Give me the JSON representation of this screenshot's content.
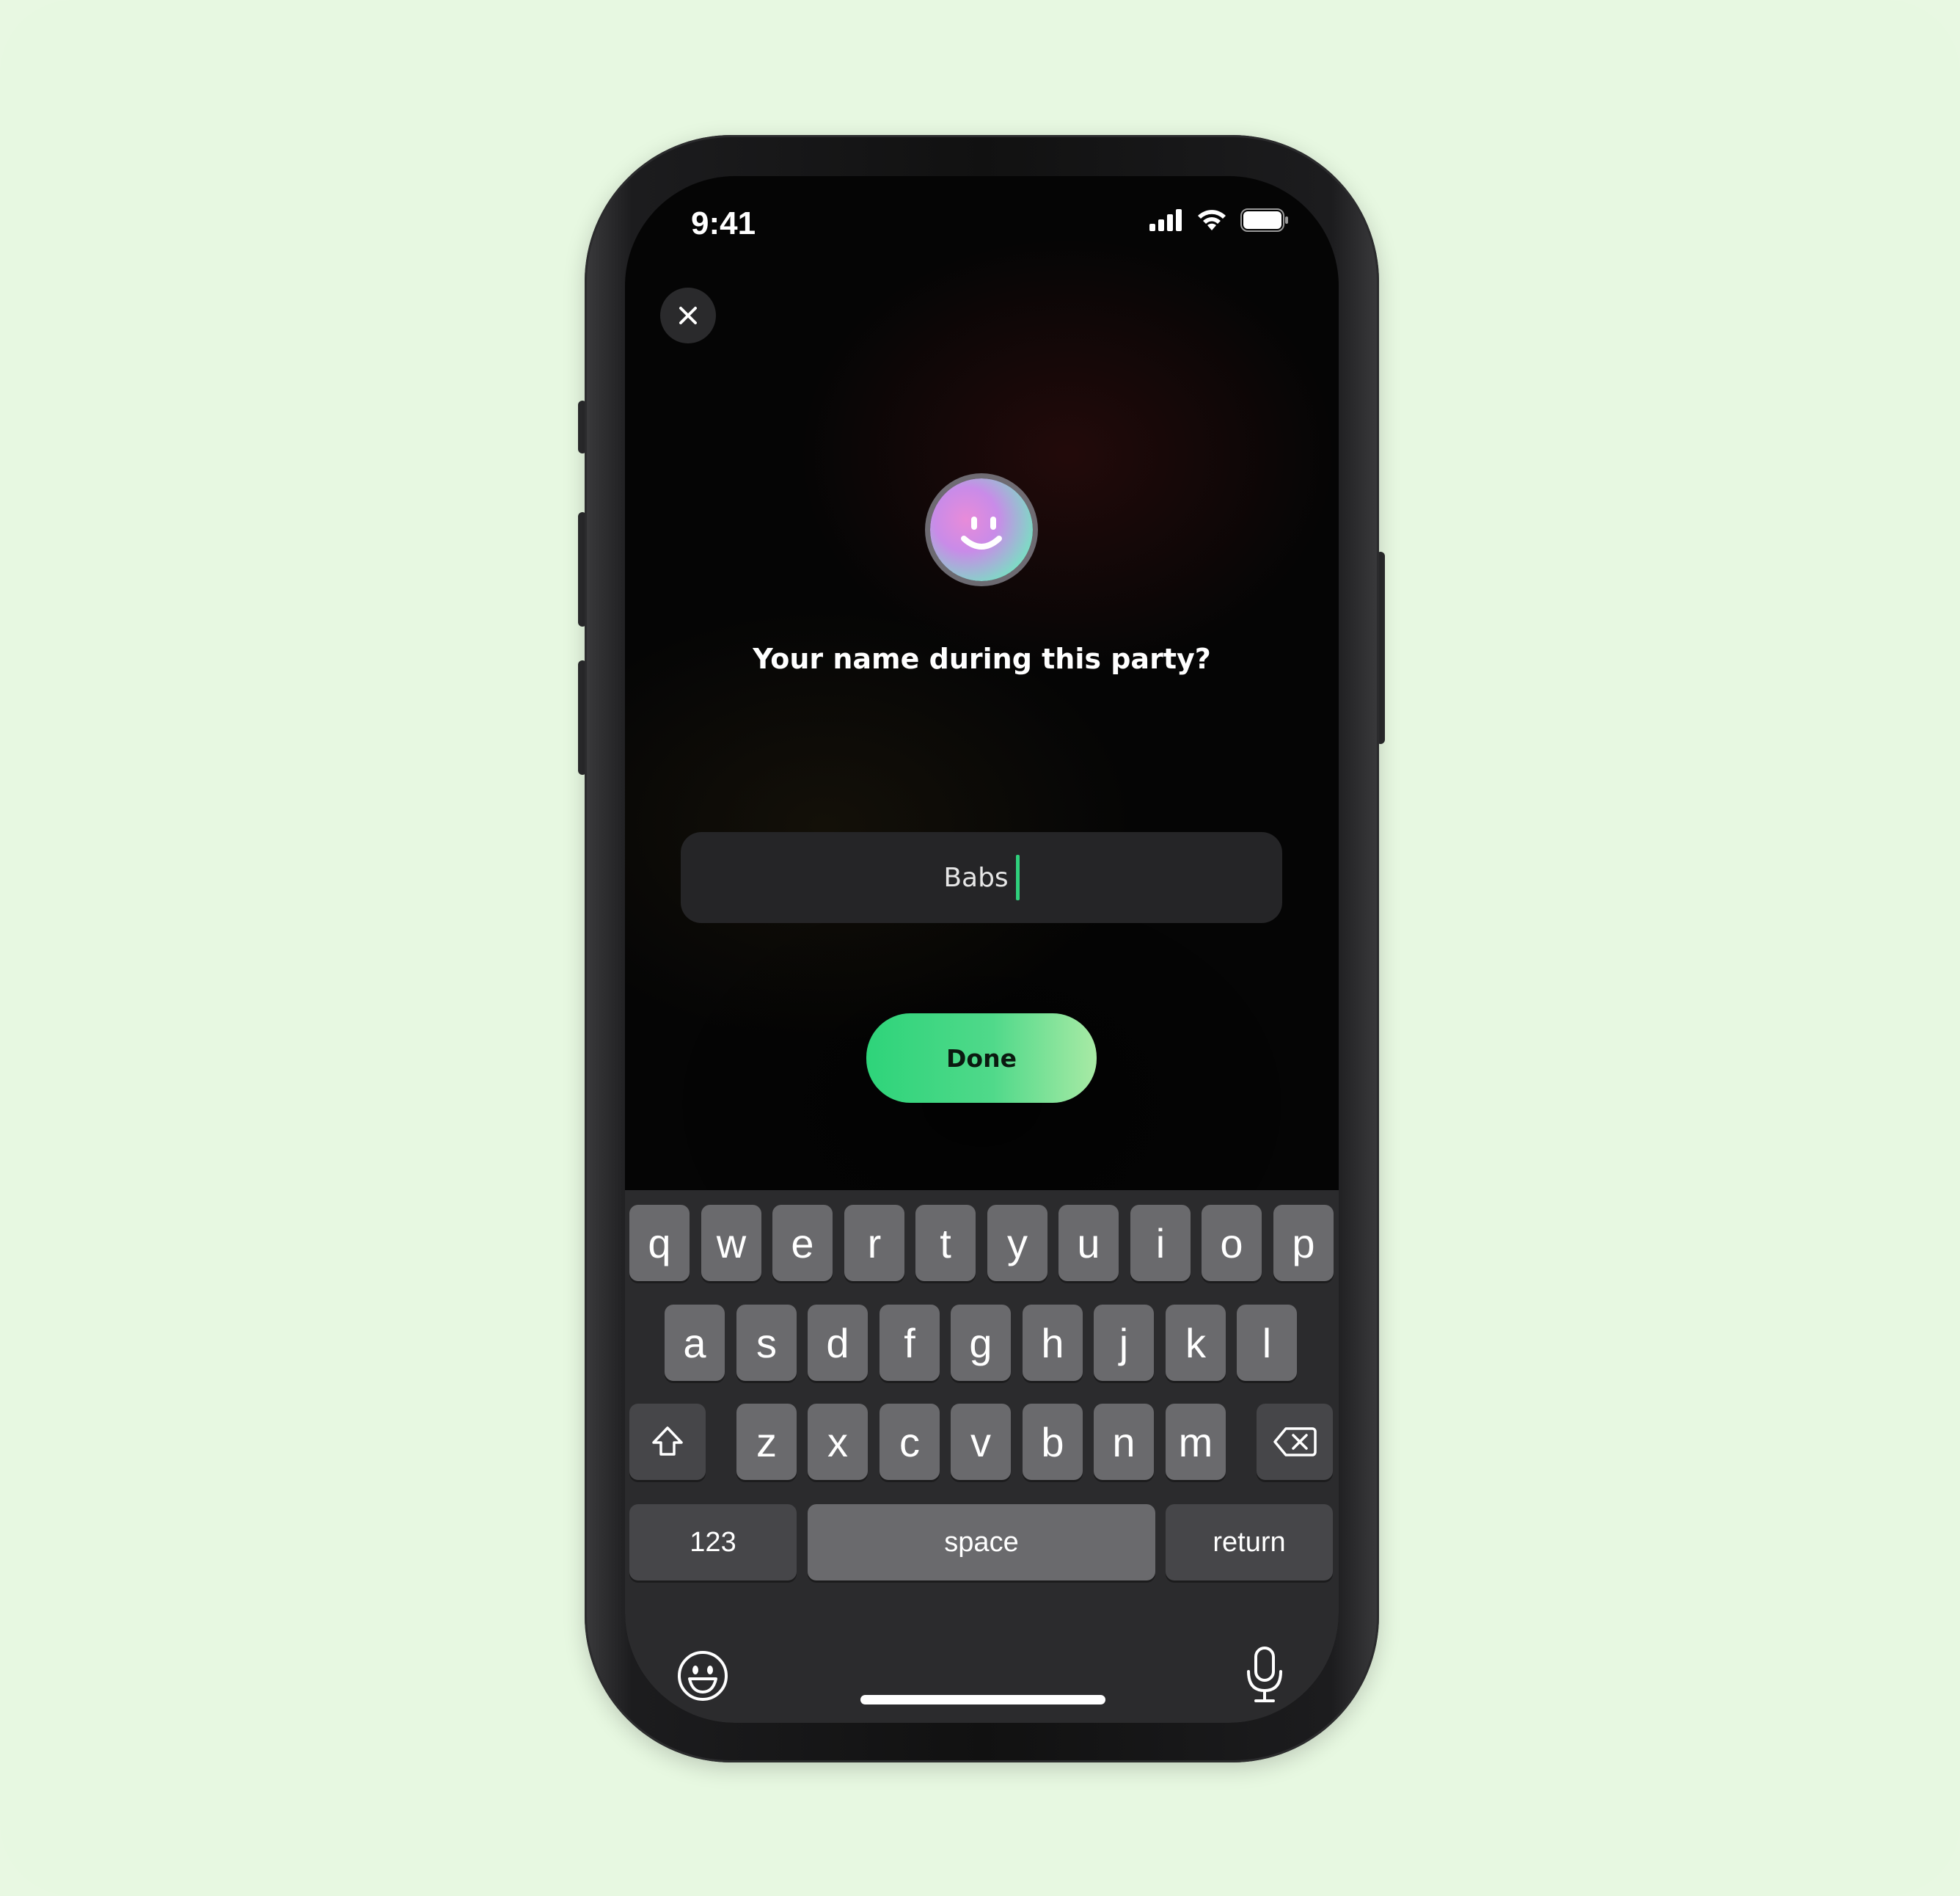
{
  "status_bar": {
    "time": "9:41",
    "icons": [
      "signal-icon",
      "wifi-icon",
      "battery-icon"
    ]
  },
  "header": {
    "close_icon": "close-icon"
  },
  "prompt": {
    "avatar_icon": "smiley-avatar-icon",
    "question": "Your name during this party?"
  },
  "name_field": {
    "value": "Babs"
  },
  "actions": {
    "done_label": "Done"
  },
  "keyboard": {
    "row1": [
      "q",
      "w",
      "e",
      "r",
      "t",
      "y",
      "u",
      "i",
      "o",
      "p"
    ],
    "row2": [
      "a",
      "s",
      "d",
      "f",
      "g",
      "h",
      "j",
      "k",
      "l"
    ],
    "row3": [
      "z",
      "x",
      "c",
      "v",
      "b",
      "n",
      "m"
    ],
    "shift_icon": "shift-icon",
    "delete_icon": "backspace-icon",
    "numbers_label": "123",
    "space_label": "space",
    "return_label": "return",
    "emoji_icon": "emoji-icon",
    "mic_icon": "microphone-icon"
  },
  "colors": {
    "background": "#e7f8e1",
    "accent_green": "#2ed47a",
    "caret": "#2fd07c",
    "key": "#6a6a6d",
    "keyboard_bg": "#2b2b2d"
  }
}
